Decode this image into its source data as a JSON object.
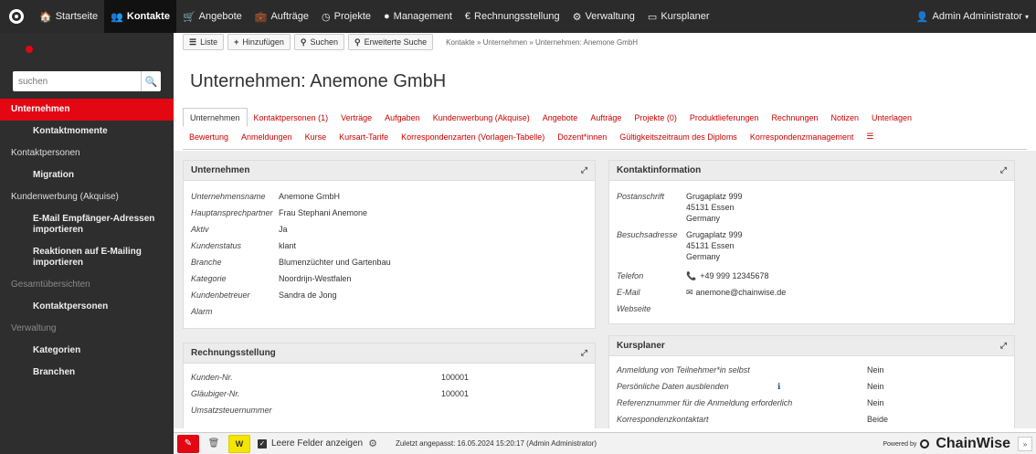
{
  "topnav": {
    "items": [
      {
        "icon": "home-icon",
        "glyph": "🏠",
        "label": "Startseite"
      },
      {
        "icon": "contacts-icon",
        "glyph": "👥",
        "label": "Kontakte"
      },
      {
        "icon": "cart-icon",
        "glyph": "🛒",
        "label": "Angebote"
      },
      {
        "icon": "briefcase-icon",
        "glyph": "💼",
        "label": "Aufträge"
      },
      {
        "icon": "clock-icon",
        "glyph": "◷",
        "label": "Projekte"
      },
      {
        "icon": "management-icon",
        "glyph": "●",
        "label": "Management"
      },
      {
        "icon": "euro-icon",
        "glyph": "€",
        "label": "Rechnungsstellung"
      },
      {
        "icon": "cogs-icon",
        "glyph": "⚙",
        "label": "Verwaltung"
      },
      {
        "icon": "calendar-icon",
        "glyph": "▭",
        "label": "Kursplaner"
      }
    ],
    "user": "Admin Administrator",
    "accent": "#e30613"
  },
  "sidebar": {
    "search_placeholder": "suchen",
    "items": [
      {
        "label": "Unternehmen",
        "kind": "active"
      },
      {
        "label": "Kontaktmomente",
        "kind": "sub"
      },
      {
        "label": "Kontaktpersonen",
        "kind": "section"
      },
      {
        "label": "Migration",
        "kind": "sub"
      },
      {
        "label": "Kundenwerbung (Akquise)",
        "kind": "section"
      },
      {
        "label": "E-Mail Empfänger-Adressen importieren",
        "kind": "sub"
      },
      {
        "label": "Reaktionen auf E-Mailing importieren",
        "kind": "sub"
      },
      {
        "label": "Gesamtübersichten",
        "kind": "muted"
      },
      {
        "label": "Kontaktpersonen",
        "kind": "sub"
      },
      {
        "label": "Verwaltung",
        "kind": "muted"
      },
      {
        "label": "Kategorien",
        "kind": "sub"
      },
      {
        "label": "Branchen",
        "kind": "sub"
      }
    ]
  },
  "toolbar": {
    "list_label": "Liste",
    "add_label": "Hinzufügen",
    "search_label": "Suchen",
    "adv_search_label": "Erweiterte Suche",
    "breadcrumb": "Kontakte  »  Unternehmen  »  Unternehmen: Anemone GmbH"
  },
  "page_title": "Unternehmen: Anemone GmbH",
  "tabs": {
    "row1": [
      "Unternehmen",
      "Kontaktpersonen (1)",
      "Verträge",
      "Aufgaben",
      "Kundenwerbung (Akquise)",
      "Angebote",
      "Aufträge",
      "Projekte (0)",
      "Produktlieferungen",
      "Rechnungen",
      "Notizen",
      "Unterlagen"
    ],
    "row2": [
      "Bewertung",
      "Anmeldungen",
      "Kurse",
      "Kursart-Tarife",
      "Korrespondenzarten (Vorlagen-Tabelle)",
      "Dozent*innen",
      "Gültigkeitszeitraum des Diploms",
      "Korrespondenzmanagement"
    ]
  },
  "unternehmen": {
    "title": "Unternehmen",
    "rows": [
      {
        "label": "Unternehmensname",
        "value": "Anemone GmbH"
      },
      {
        "label": "Hauptansprechpartner",
        "value": "Frau Stephani Anemone"
      },
      {
        "label": "Aktiv",
        "value": "Ja"
      },
      {
        "label": "Kundenstatus",
        "value": "klant"
      },
      {
        "label": "Branche",
        "value": "Blumenzüchter und Gartenbau"
      },
      {
        "label": "Kategorie",
        "value": "Noordrijn-Westfalen"
      },
      {
        "label": "Kundenbetreuer",
        "value": "Sandra de Jong"
      },
      {
        "label": "Alarm",
        "value": ""
      }
    ]
  },
  "rechnung": {
    "title": "Rechnungsstellung",
    "rows": [
      {
        "label": "Kunden-Nr.",
        "value": "100001"
      },
      {
        "label": "Gläubiger-Nr.",
        "value": "100001"
      },
      {
        "label": "Umsatzsteuernummer",
        "value": ""
      }
    ]
  },
  "kontakt": {
    "title": "Kontaktinformation",
    "postanschrift_label": "Postanschrift",
    "postanschrift": [
      "Grugaplatz 999",
      "45131 Essen",
      "Germany"
    ],
    "besuchsadresse_label": "Besuchsadresse",
    "besuchsadresse": [
      "Grugaplatz 999",
      "45131 Essen",
      "Germany"
    ],
    "telefon_label": "Telefon",
    "telefon": "+49 999 12345678",
    "email_label": "E-Mail",
    "email": "anemone@chainwise.de",
    "webseite_label": "Webseite"
  },
  "kursplaner": {
    "title": "Kursplaner",
    "rows": [
      {
        "label": "Anmeldung von Teilnehmer*in selbst",
        "value": "Nein"
      },
      {
        "label": "Persönliche Daten ausblenden",
        "value": "Nein"
      },
      {
        "label": "Referenznummer für die Anmeldung erforderlich",
        "value": "Nein"
      },
      {
        "label": "Korrespondenzkontaktart",
        "value": "Beide"
      }
    ]
  },
  "bottombar": {
    "empty_fields_label": "Leere Felder anzeigen",
    "last_modified": "Zuletzt angepasst: 16.05.2024 15:20:17 (Admin Administrator)",
    "powered_by": "Powered by",
    "brand": "ChainWise"
  }
}
